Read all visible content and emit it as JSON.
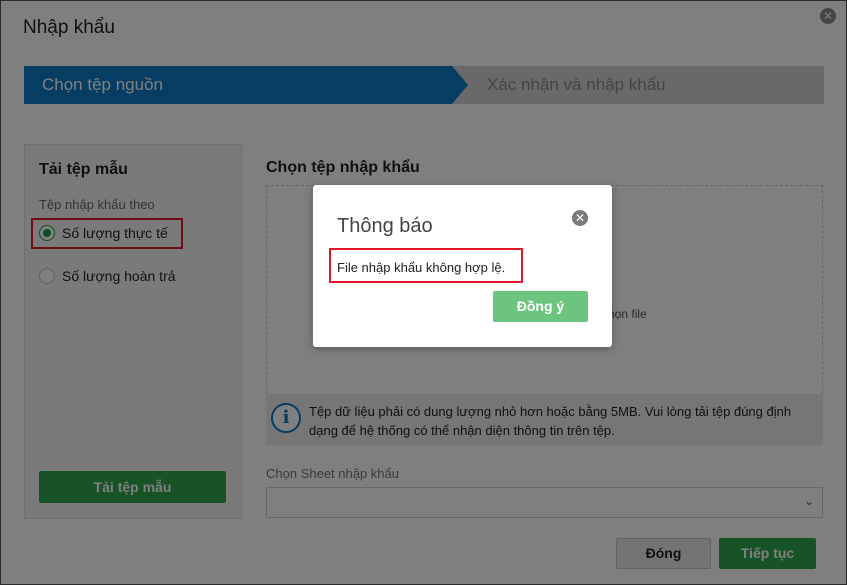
{
  "dialog": {
    "title": "Nhập khẩu",
    "close_icon": "close-circle-icon"
  },
  "steps": {
    "active": "Chọn tệp nguồn",
    "inactive": "Xác nhận và nhập khẩu"
  },
  "sidebar": {
    "title": "Tải tệp mẫu",
    "subtitle": "Tệp nhập khẩu theo",
    "options": [
      {
        "label": "Số lượng thực tế",
        "checked": true
      },
      {
        "label": "Số lượng hoàn trả",
        "checked": false
      }
    ],
    "download_label": "Tải tệp mẫu"
  },
  "main": {
    "title": "Chọn tệp nhập khẩu",
    "drop_hint_partial": "họn file",
    "info_icon": "info-icon",
    "info_text": "Tệp dữ liệu phải có dung lượng nhỏ hơn hoặc bằng 5MB. Vui lòng tải tệp đúng định dạng để hệ thống có thể nhận diện thông tin trên tệp.",
    "sheet_label": "Chọn Sheet nhập khẩu",
    "sheet_value": ""
  },
  "footer": {
    "close_label": "Đóng",
    "next_label": "Tiếp tục"
  },
  "modal": {
    "title": "Thông báo",
    "message": "File nhập khẩu không hợp lệ.",
    "ok_label": "Đồng ý"
  },
  "colors": {
    "primary_blue": "#0f78c7",
    "green": "#2fa64f",
    "modal_green": "#6cc47f",
    "highlight_red": "#e0182a"
  }
}
